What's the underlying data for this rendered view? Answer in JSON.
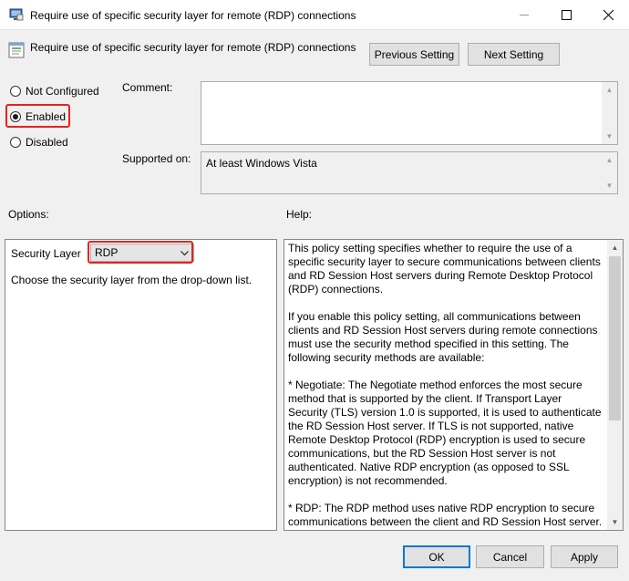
{
  "window": {
    "title": "Require use of specific security layer for remote (RDP) connections",
    "controls": [
      "minimize",
      "maximize",
      "close"
    ]
  },
  "header": {
    "policy_name": "Require use of specific security layer for remote (RDP) connections",
    "previous_button": "Previous Setting",
    "next_button": "Next Setting"
  },
  "state": {
    "options": [
      {
        "label": "Not Configured",
        "selected": false
      },
      {
        "label": "Enabled",
        "selected": true
      },
      {
        "label": "Disabled",
        "selected": false
      }
    ]
  },
  "comment": {
    "label": "Comment:",
    "value": ""
  },
  "supported": {
    "label": "Supported on:",
    "value": "At least Windows Vista"
  },
  "options_section": {
    "label": "Options:",
    "security_layer_label": "Security Layer",
    "security_layer_value": "RDP",
    "description": "Choose the security layer from the drop-down list."
  },
  "help_section": {
    "label": "Help:",
    "paragraphs": [
      "This policy setting specifies whether to require the use of a specific security layer to secure communications between clients and RD Session Host servers during Remote Desktop Protocol (RDP) connections.",
      "If you enable this policy setting, all communications between clients and RD Session Host servers during remote connections must use the security method specified in this setting. The following security methods are available:",
      "* Negotiate: The Negotiate method enforces the most secure method that is supported by the client. If Transport Layer Security (TLS) version 1.0 is supported, it is used to authenticate the RD Session Host server. If TLS is not supported, native Remote Desktop Protocol (RDP) encryption is used to secure communications, but the RD Session Host server is not authenticated. Native RDP encryption (as opposed to SSL encryption) is not recommended.",
      "* RDP: The RDP method uses native RDP encryption to secure communications between the client and RD Session Host server."
    ]
  },
  "footer": {
    "ok": "OK",
    "cancel": "Cancel",
    "apply": "Apply"
  },
  "colors": {
    "highlight": "#e8211f",
    "focus": "#0078d7"
  }
}
